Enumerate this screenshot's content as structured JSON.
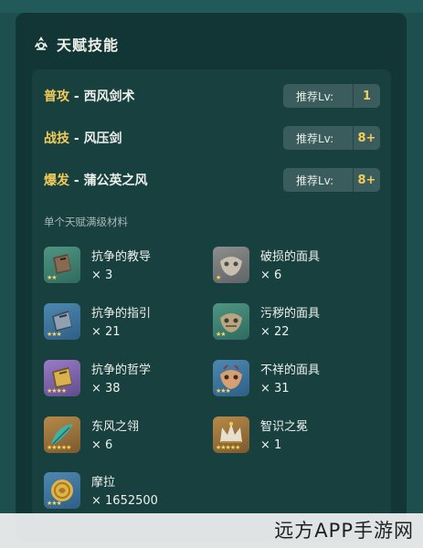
{
  "card": {
    "title": "天赋技能",
    "title_icon": "talent-icon"
  },
  "skills": [
    {
      "type": "普攻",
      "separator": " - ",
      "name": "西风剑术",
      "lv_label": "推荐Lv:",
      "lv_value": "1"
    },
    {
      "type": "战技",
      "separator": " - ",
      "name": "风压剑",
      "lv_label": "推荐Lv:",
      "lv_value": "8+"
    },
    {
      "type": "爆发",
      "separator": " - ",
      "name": "蒲公英之风",
      "lv_label": "推荐Lv:",
      "lv_value": "8+"
    }
  ],
  "materials_header": "单个天赋满级材料",
  "materials": [
    {
      "name": "抗争的教导",
      "count": "× 3",
      "stars": "★★",
      "rarity": "green",
      "icon": "book-icon"
    },
    {
      "name": "破损的面具",
      "count": "× 6",
      "stars": "★",
      "rarity": "grey",
      "icon": "mask-icon"
    },
    {
      "name": "抗争的指引",
      "count": "× 21",
      "stars": "★★★",
      "rarity": "blue",
      "icon": "book-icon"
    },
    {
      "name": "污秽的面具",
      "count": "× 22",
      "stars": "★★",
      "rarity": "green",
      "icon": "mask-icon"
    },
    {
      "name": "抗争的哲学",
      "count": "× 38",
      "stars": "★★★★",
      "rarity": "purple",
      "icon": "book-icon"
    },
    {
      "name": "不祥的面具",
      "count": "× 31",
      "stars": "★★★",
      "rarity": "blue",
      "icon": "mask-icon"
    },
    {
      "name": "东风之翎",
      "count": "× 6",
      "stars": "★★★★★",
      "rarity": "gold",
      "icon": "feather-icon"
    },
    {
      "name": "智识之冕",
      "count": "× 1",
      "stars": "★★★★★",
      "rarity": "gold",
      "icon": "crown-icon"
    },
    {
      "name": "摩拉",
      "count": "× 1652500",
      "stars": "★★★",
      "rarity": "blue",
      "icon": "coin-icon"
    }
  ],
  "colors": {
    "background": "#1d4f4e",
    "card": "#123636",
    "panel": "#18403f",
    "accent": "#f2cc5a"
  },
  "watermark": "远方APP手游网"
}
